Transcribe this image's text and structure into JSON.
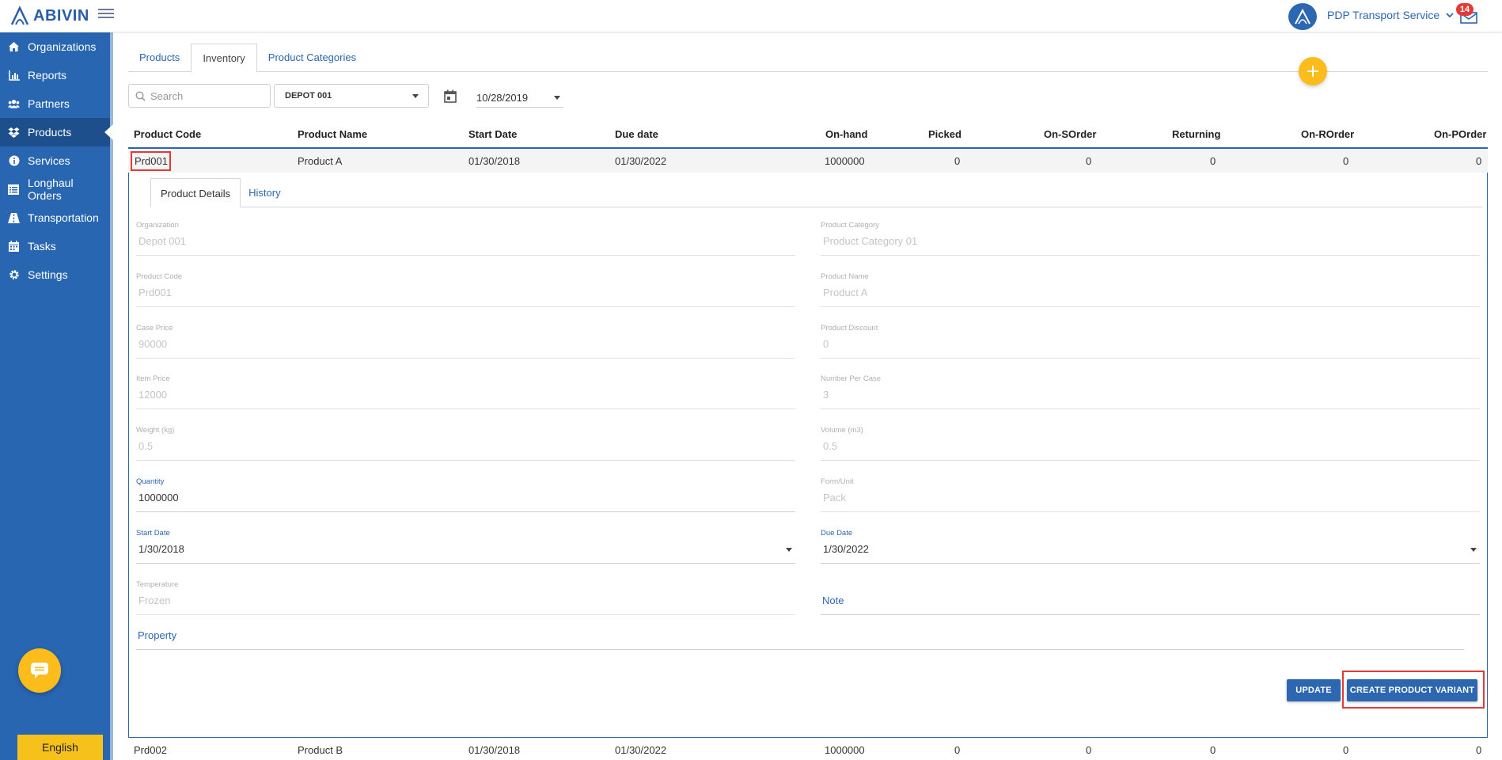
{
  "app": {
    "brand": "ABIVIN",
    "org_name": "PDP Transport Service",
    "notification_count": "14"
  },
  "sidebar": {
    "items": [
      {
        "label": "Organizations",
        "icon": "home-icon"
      },
      {
        "label": "Reports",
        "icon": "bar-chart-icon"
      },
      {
        "label": "Partners",
        "icon": "users-icon"
      },
      {
        "label": "Products",
        "icon": "dropbox-icon",
        "active": true
      },
      {
        "label": "Services",
        "icon": "info-icon"
      },
      {
        "label": "Longhaul Orders",
        "icon": "list-icon"
      },
      {
        "label": "Transportation",
        "icon": "road-icon"
      },
      {
        "label": "Tasks",
        "icon": "calendar-icon"
      },
      {
        "label": "Settings",
        "icon": "gear-icon"
      }
    ],
    "language": "English"
  },
  "main": {
    "tabs": [
      "Products",
      "Inventory",
      "Product Categories"
    ],
    "active_tab": "Inventory",
    "filters": {
      "search_placeholder": "Search",
      "depot": "DEPOT 001",
      "date": "10/28/2019"
    },
    "table": {
      "headers": [
        "Product Code",
        "Product Name",
        "Start Date",
        "Due date",
        "On-hand",
        "Picked",
        "On-SOrder",
        "Returning",
        "On-ROrder",
        "On-POrder"
      ],
      "rows": [
        [
          "Prd001",
          "Product A",
          "01/30/2018",
          "01/30/2022",
          "1000000",
          "0",
          "0",
          "0",
          "0",
          "0"
        ],
        [
          "Prd002",
          "Product B",
          "01/30/2018",
          "01/30/2022",
          "1000000",
          "0",
          "0",
          "0",
          "0",
          "0"
        ]
      ]
    },
    "detail": {
      "tabs": [
        "Product Details",
        "History"
      ],
      "fields": {
        "organization": {
          "label": "Organization",
          "value": "Depot 001"
        },
        "product_category": {
          "label": "Product Category",
          "value": "Product Category 01"
        },
        "product_code": {
          "label": "Product Code",
          "value": "Prd001"
        },
        "product_name": {
          "label": "Product Name",
          "value": "Product A"
        },
        "case_price": {
          "label": "Case Price",
          "value": "90000"
        },
        "product_discount": {
          "label": "Product Discount",
          "value": "0"
        },
        "item_price": {
          "label": "Item Price",
          "value": "12000"
        },
        "number_per_case": {
          "label": "Number Per Case",
          "value": "3"
        },
        "weight": {
          "label": "Weight (kg)",
          "value": "0.5"
        },
        "volume": {
          "label": "Volume (m3)",
          "value": "0.5"
        },
        "quantity": {
          "label": "Quantity",
          "value": "1000000"
        },
        "form_unit": {
          "label": "Form/Unit",
          "value": "Pack"
        },
        "start_date": {
          "label": "Start Date",
          "value": "1/30/2018"
        },
        "due_date": {
          "label": "Due Date",
          "value": "1/30/2022"
        },
        "temperature": {
          "label": "Temperature",
          "value": "Frozen"
        },
        "note": {
          "label": "Note"
        },
        "property": {
          "label": "Property"
        }
      },
      "buttons": {
        "update": "UPDATE",
        "create_variant": "CREATE PRODUCT VARIANT"
      }
    }
  }
}
